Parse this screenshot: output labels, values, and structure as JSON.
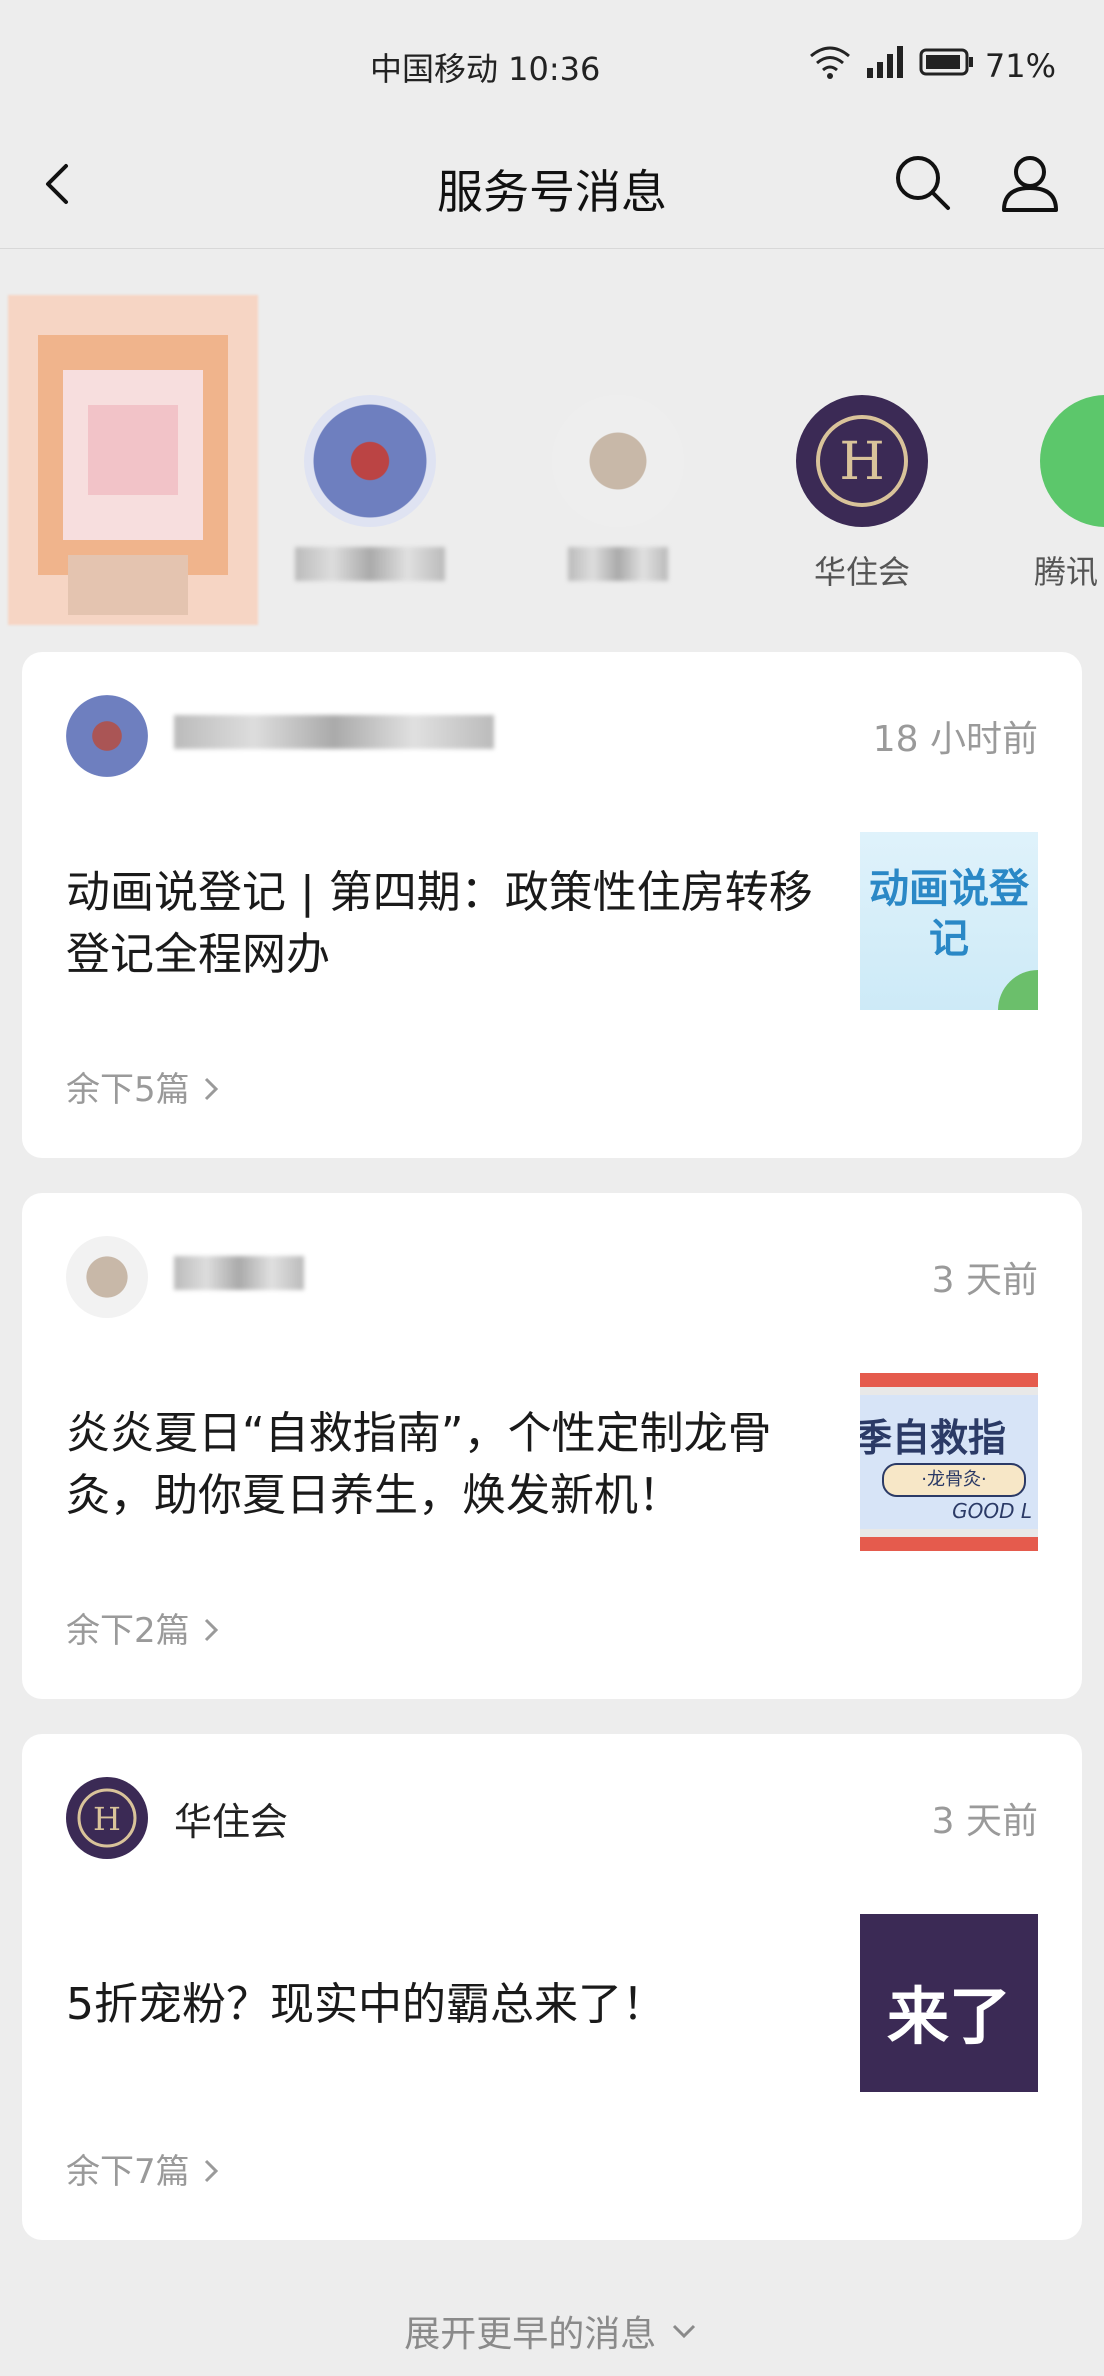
{
  "status_bar": {
    "carrier_time": "中国移动 10:36",
    "battery": "71%"
  },
  "nav": {
    "title": "服务号消息"
  },
  "accounts": [
    {
      "name": ""
    },
    {
      "name": ""
    },
    {
      "name": ""
    },
    {
      "name": "华住会"
    },
    {
      "name": "腾讯"
    }
  ],
  "cards": [
    {
      "account": "",
      "time": "18 小时前",
      "message": "动画说登记 | 第四期：政策性住房转移登记全程网办",
      "thumb_text": "动画说登记",
      "more": "余下5篇"
    },
    {
      "account": "",
      "time": "3 天前",
      "message": "炎炎夏日“自救指南”，个性定制龙骨灸，助你夏日养生，焕发新机！",
      "thumb_text": "季自救指",
      "thumb_sub": "·龙骨灸·",
      "thumb_sign": "GOOD L",
      "more": "余下2篇"
    },
    {
      "account": "华住会",
      "time": "3 天前",
      "message": "5折宠粉？现实中的霸总来了！",
      "thumb_text": "来了",
      "more": "余下7篇"
    }
  ],
  "footer": {
    "label": "展开更早的消息"
  },
  "colors": {
    "huazhu": "#3b2a55",
    "bg": "#ededed",
    "card": "#ffffff"
  }
}
